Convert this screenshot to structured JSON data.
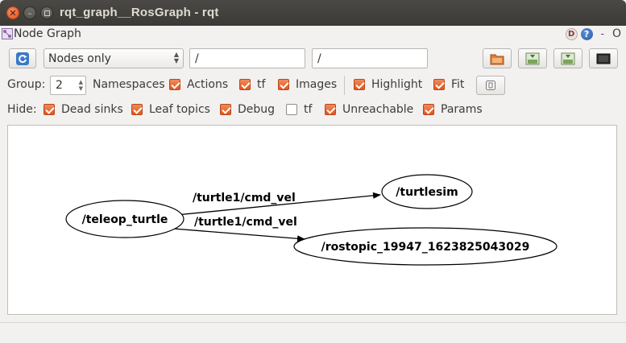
{
  "window": {
    "title": "rqt_graph__RosGraph - rqt"
  },
  "dock": {
    "title": "Node Graph",
    "d_label": "D",
    "help_label": "?",
    "dash_label": "-",
    "close_label": "O"
  },
  "toolbar": {
    "filter_mode": "Nodes only",
    "namespace_filter": "/",
    "topic_filter": "/"
  },
  "options": {
    "group_label": "Group:",
    "group_value": "2",
    "namespaces": {
      "label": "Namespaces",
      "checked": true
    },
    "actions": {
      "label": "Actions",
      "checked": true
    },
    "tf": {
      "label": "tf",
      "checked": true
    },
    "images": {
      "label": "Images",
      "checked": true
    },
    "highlight": {
      "label": "Highlight",
      "checked": true
    },
    "fit": {
      "label": "Fit",
      "checked": true
    }
  },
  "hide": {
    "label": "Hide:",
    "dead_sinks": {
      "label": "Dead sinks",
      "checked": true
    },
    "leaf_topics": {
      "label": "Leaf topics",
      "checked": true
    },
    "debug": {
      "label": "Debug",
      "checked": true
    },
    "tf": {
      "label": "tf",
      "checked": false
    },
    "unreachable": {
      "label": "Unreachable",
      "checked": true
    },
    "params": {
      "label": "Params",
      "checked": true
    }
  },
  "graph": {
    "nodes": {
      "teleop": "/teleop_turtle",
      "turtlesim": "/turtlesim",
      "rostopic": "/rostopic_19947_1623825043029"
    },
    "edges": {
      "to_turtlesim": "/turtle1/cmd_vel",
      "to_rostopic": "/turtle1/cmd_vel"
    }
  },
  "colors": {
    "accent": "#e1571c",
    "titlebar": "#3b3a36"
  }
}
